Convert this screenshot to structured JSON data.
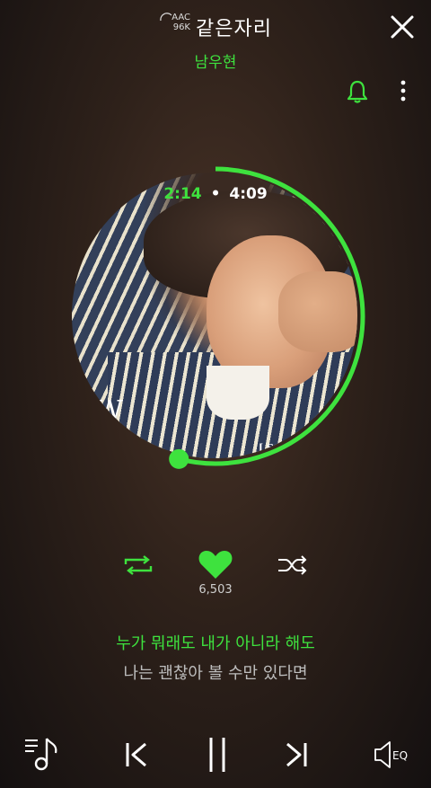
{
  "header": {
    "quality_codec": "AAC",
    "quality_rate": "96K",
    "title": "같은자리",
    "artist": "남우현",
    "icons": {
      "close": "close-icon",
      "bell": "bell-icon",
      "more": "more-vertical-icon"
    }
  },
  "player": {
    "elapsed": "2:14",
    "separator": "•",
    "total": "4:09",
    "progress_fraction": 0.54,
    "album_logo_text": "W",
    "album_subtitle": "[ Secon",
    "likes": "6,503",
    "accent_color": "#3ee23e"
  },
  "lyrics": {
    "current": "누가 뭐래도 내가 아니라 해도",
    "next": "나는 괜찮아 볼 수만 있다면"
  },
  "controls": {
    "repeat": "repeat-icon",
    "like": "heart-icon",
    "shuffle": "shuffle-icon",
    "playlist": "playlist-icon",
    "prev": "previous-icon",
    "pause": "pause-icon",
    "next": "next-icon",
    "eq_label": "EQ"
  }
}
